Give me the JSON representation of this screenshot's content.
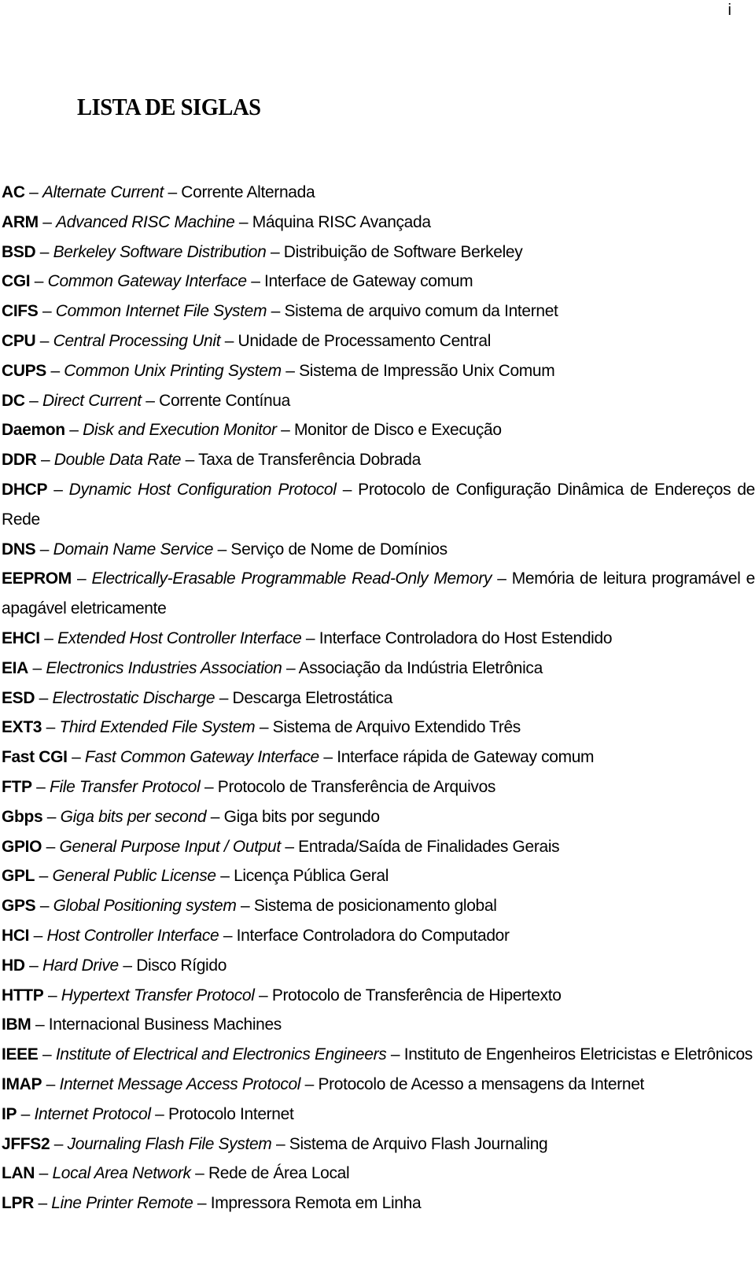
{
  "page": {
    "number": "i",
    "title": "LISTA DE SIGLAS"
  },
  "dash": "–",
  "entries": [
    {
      "abbr": "AC",
      "english": "Alternate Current",
      "portuguese": "Corrente Alternada"
    },
    {
      "abbr": "ARM",
      "english": "Advanced RISC Machine",
      "portuguese": "Máquina RISC Avançada"
    },
    {
      "abbr": "BSD",
      "english": "Berkeley Software Distribution",
      "portuguese": "Distribuição de Software Berkeley"
    },
    {
      "abbr": "CGI",
      "english": "Common Gateway Interface",
      "portuguese": "Interface de Gateway comum"
    },
    {
      "abbr": "CIFS",
      "english": "Common Internet File System",
      "portuguese": "Sistema de arquivo comum da Internet"
    },
    {
      "abbr": "CPU",
      "english": "Central Processing Unit",
      "portuguese": "Unidade de Processamento Central"
    },
    {
      "abbr": "CUPS",
      "english": "Common Unix Printing System",
      "portuguese": "Sistema de Impressão Unix Comum"
    },
    {
      "abbr": "DC",
      "english": "Direct Current",
      "portuguese": "Corrente Contínua"
    },
    {
      "abbr": "Daemon",
      "english": "Disk and Execution Monitor",
      "portuguese": "Monitor de Disco e Execução"
    },
    {
      "abbr": "DDR",
      "english": "Double Data Rate",
      "portuguese": "Taxa de Transferência Dobrada"
    },
    {
      "abbr": "DHCP",
      "english": "Dynamic Host Configuration Protocol",
      "portuguese": "Protocolo de Configuração Dinâmica de Endereços de Rede"
    },
    {
      "abbr": "DNS",
      "english": "Domain Name Service",
      "portuguese": "Serviço de Nome de Domínios"
    },
    {
      "abbr": "EEPROM",
      "english": "Electrically-Erasable Programmable Read-Only Memory",
      "portuguese": "Memória de leitura programável e apagável eletricamente"
    },
    {
      "abbr": "EHCI",
      "english": "Extended Host Controller Interface",
      "portuguese": "Interface Controladora do Host Estendido"
    },
    {
      "abbr": "EIA",
      "english": "Electronics Industries Association",
      "portuguese": "Associação da Indústria Eletrônica"
    },
    {
      "abbr": "ESD",
      "english": "Electrostatic Discharge",
      "portuguese": "Descarga Eletrostática"
    },
    {
      "abbr": "EXT3",
      "english": "Third Extended File System",
      "portuguese": "Sistema de Arquivo Extendido Três"
    },
    {
      "abbr": "Fast CGI",
      "english": "Fast Common Gateway Interface",
      "portuguese": "Interface rápida de Gateway comum"
    },
    {
      "abbr": "FTP",
      "english": "File Transfer Protocol",
      "portuguese": "Protocolo de Transferência de Arquivos"
    },
    {
      "abbr": "Gbps",
      "english": "Giga bits per second",
      "portuguese": "Giga bits por segundo"
    },
    {
      "abbr": "GPIO",
      "english": "General Purpose Input / Output",
      "portuguese": "Entrada/Saída de Finalidades Gerais"
    },
    {
      "abbr": "GPL",
      "english": "General Public License",
      "portuguese": "Licença Pública Geral"
    },
    {
      "abbr": "GPS",
      "english": "Global Positioning system",
      "portuguese": "Sistema de posicionamento global"
    },
    {
      "abbr": "HCI",
      "english": "Host Controller Interface",
      "portuguese": "Interface Controladora do Computador"
    },
    {
      "abbr": "HD",
      "english": "Hard Drive",
      "portuguese": "Disco Rígido"
    },
    {
      "abbr": "HTTP",
      "english": "Hypertext Transfer Protocol",
      "portuguese": "Protocolo de Transferência de Hipertexto"
    },
    {
      "abbr": "IBM",
      "english": "",
      "portuguese": "Internacional Business Machines"
    },
    {
      "abbr": "IEEE",
      "english": "Institute of Electrical and Electronics Engineers",
      "portuguese": "Instituto de Engenheiros Eletricistas e Eletrônicos"
    },
    {
      "abbr": "IMAP",
      "english": "Internet Message Access Protocol",
      "portuguese": "Protocolo de Acesso a mensagens da Internet"
    },
    {
      "abbr": "IP",
      "english": "Internet Protocol",
      "portuguese": "Protocolo Internet"
    },
    {
      "abbr": "JFFS2",
      "english": "Journaling Flash File System",
      "portuguese": "Sistema de Arquivo Flash Journaling"
    },
    {
      "abbr": "LAN",
      "english": "Local Area Network",
      "portuguese": "Rede de Área Local"
    },
    {
      "abbr": "LPR",
      "english": "Line Printer Remote",
      "portuguese": "Impressora Remota em Linha"
    }
  ]
}
